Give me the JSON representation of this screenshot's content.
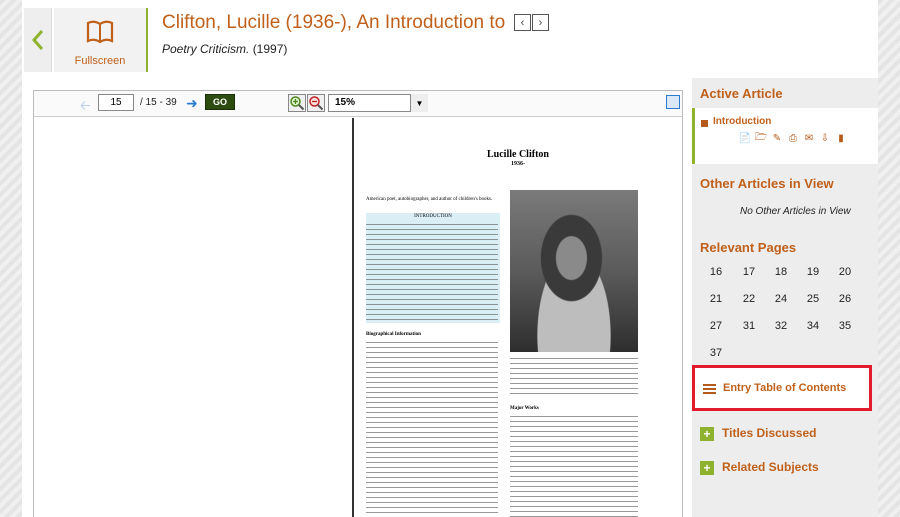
{
  "header": {
    "fullscreen_label": "Fullscreen",
    "title": "Clifton, Lucille (1936-), An Introduction to",
    "source_title": "Poetry Criticism.",
    "source_year": "(1997)"
  },
  "toolbar": {
    "page_value": "15",
    "page_range": "/ 15 - 39",
    "go_label": "GO",
    "zoom_value": "15%"
  },
  "document": {
    "name": "Lucille Clifton",
    "year": "1936-",
    "lead": "American poet, autobiographer, and author of children's books.",
    "intro_heading": "INTRODUCTION",
    "bio_heading": "Biographical Information",
    "major_heading": "Major Works"
  },
  "sidebar": {
    "active_heading": "Active Article",
    "active_item": "Introduction",
    "other_heading": "Other Articles in View",
    "other_empty": "No Other Articles in View",
    "relevant_heading": "Relevant Pages",
    "pages": [
      "16",
      "17",
      "18",
      "19",
      "20",
      "21",
      "22",
      "24",
      "25",
      "26",
      "27",
      "31",
      "32",
      "34",
      "35",
      "37"
    ],
    "toc_label": "Entry Table of Contents",
    "titles_label": "Titles Discussed",
    "subjects_label": "Related Subjects"
  },
  "colors": {
    "accent": "#c0601a",
    "green": "#8fb22e",
    "highlight_border": "#e21a2a"
  }
}
